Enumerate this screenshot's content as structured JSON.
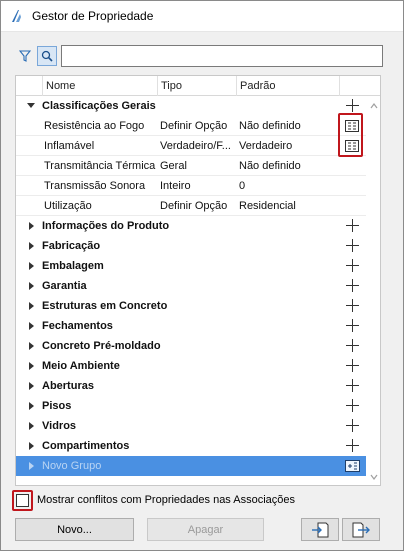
{
  "window": {
    "title": "Gestor de Propriedade"
  },
  "search": {
    "value": "",
    "placeholder": ""
  },
  "columns": {
    "name": "Nome",
    "type": "Tipo",
    "default": "Padrão"
  },
  "expanded_group": {
    "label": "Classificações Gerais",
    "items": [
      {
        "name": "Resistência ao Fogo",
        "type": "Definir Opção",
        "default": "Não definido",
        "icon": "property-card-icon"
      },
      {
        "name": "Inflamável",
        "type": "Verdadeiro/F...",
        "default": "Verdadeiro",
        "icon": "property-card-icon"
      },
      {
        "name": "Transmitância Térmica",
        "type": "Geral",
        "default": "Não definido"
      },
      {
        "name": "Transmissão Sonora",
        "type": "Inteiro",
        "default": "0"
      },
      {
        "name": "Utilização",
        "type": "Definir Opção",
        "default": "Residencial"
      }
    ]
  },
  "groups": [
    "Informações do Produto",
    "Fabricação",
    "Embalagem",
    "Garantia",
    "Estruturas em Concreto",
    "Fechamentos",
    "Concreto Pré-moldado",
    "Meio Ambiente",
    "Aberturas",
    "Pisos",
    "Vidros",
    "Compartimentos"
  ],
  "new_group": {
    "label": "Novo Grupo"
  },
  "footer": {
    "checkbox_label": "Mostrar conflitos com Propriedades nas Associações",
    "checkbox_checked": false,
    "new_button": "Novo...",
    "delete_button": "Apagar"
  },
  "colors": {
    "accent": "#4a90e2",
    "highlight": "#c0161c"
  }
}
